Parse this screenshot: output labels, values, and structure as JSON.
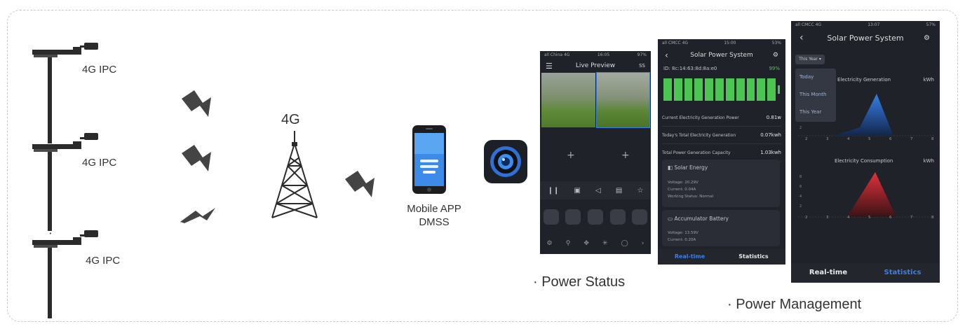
{
  "diagram": {
    "ipc_labels": [
      "4G IPC",
      "4G IPC",
      "4G IPC"
    ],
    "ellipsis": "⋮",
    "tower_label": "4G",
    "app_label_line1": "Mobile APP",
    "app_label_line2": "DMSS",
    "caption_status": "· Power Status",
    "caption_management": "· Power Management"
  },
  "phone1": {
    "status_left": "all China 4G",
    "status_time": "16:05",
    "status_right": "97%",
    "title": "Live Preview",
    "corner": "SS",
    "plus": "+"
  },
  "phone2": {
    "status_left": "all CMCC 4G",
    "status_time": "15:00",
    "status_right": "53%",
    "title": "Solar Power System",
    "id_label": "ID: 8c:14:63:8d:8a:e0",
    "battery_pct": "99%",
    "battery_bars": 11,
    "rows": [
      {
        "label": "Current Electricity Generation Power",
        "value": "0.81w"
      },
      {
        "label": "Today's Total Electricity Generation",
        "value": "0.07kwh"
      },
      {
        "label": "Total Power Generation Capacity",
        "value": "1.03kwh"
      }
    ],
    "solar_title": "Solar Energy",
    "solar_lines": [
      "Voltage: 20.29V",
      "Current: 0.04A",
      "Working Status: Normal"
    ],
    "battery_title": "Accumulator Battery",
    "battery_lines": [
      "Voltage: 13.59V",
      "Current: 0.20A"
    ],
    "tab_realtime": "Real-time",
    "tab_statistics": "Statistics"
  },
  "phone3": {
    "status_left": "all CMCC 4G",
    "status_time": "13:07",
    "status_right": "57%",
    "title": "Solar Power System",
    "dropdown_value": "This Year",
    "menu_items": [
      "Today",
      "This Month",
      "This Year"
    ],
    "gen_title": "Electricity Generation",
    "gen_unit": "kWh",
    "cons_title": "Electricity Consumption",
    "cons_unit": "kWh",
    "x_ticks": [
      "2",
      "3",
      "4",
      "5",
      "6",
      "7",
      "8"
    ],
    "tab_realtime": "Real-time",
    "tab_statistics": "Statistics"
  },
  "colors": {
    "phone_bg": "#1f2229",
    "accent_blue": "#3d7ee6",
    "battery_green": "#4cc553",
    "gen_fill": "#2f6fd6",
    "cons_fill": "#c8262d"
  }
}
